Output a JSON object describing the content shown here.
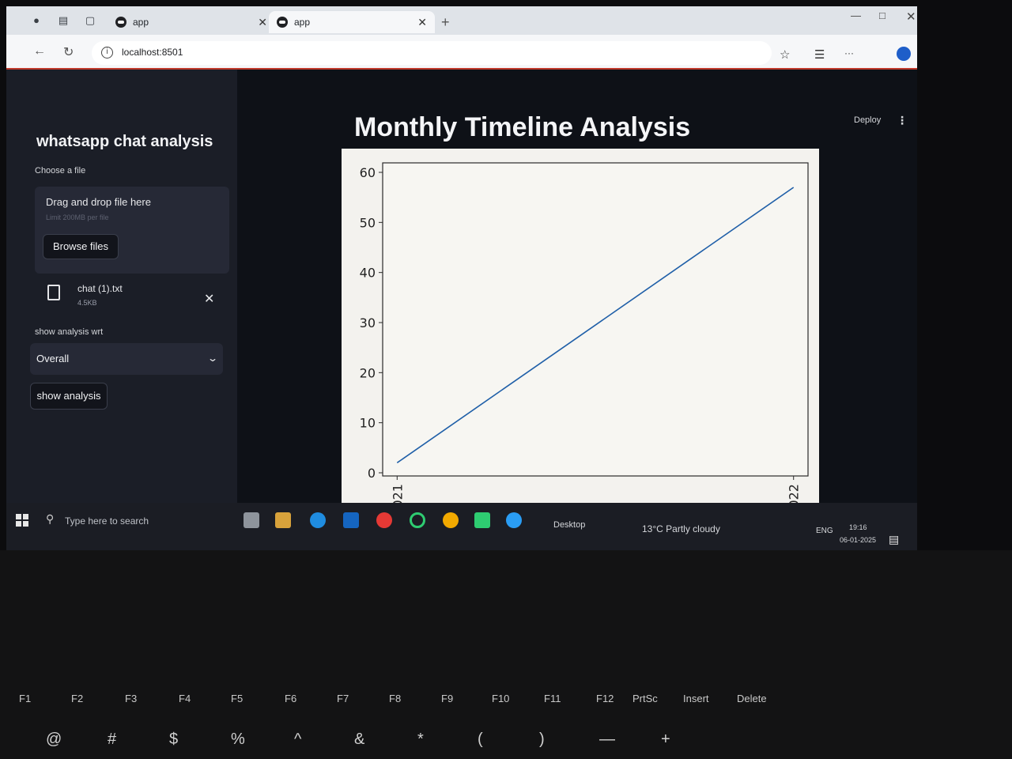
{
  "browser": {
    "tabs": [
      {
        "label": "app"
      },
      {
        "label": "app"
      }
    ],
    "url": "localhost:8501"
  },
  "sidebar": {
    "title": "whatsapp chat analysis",
    "file_label": "Choose a file",
    "drop_title": "Drag and drop file here",
    "drop_limit": "Limit 200MB per file",
    "browse_label": "Browse files",
    "uploaded_file": {
      "name": "chat (1).txt",
      "size": "4.5KB"
    },
    "select_label": "show analysis wrt",
    "select_value": "Overall",
    "show_button": "show analysis"
  },
  "header": {
    "deploy_label": "Deploy"
  },
  "main": {
    "page_title": "Monthly Timeline Analysis"
  },
  "chart_data": {
    "type": "line",
    "title": "",
    "xlabel": "",
    "ylabel": "",
    "x_tick_labels": [
      "021",
      "022"
    ],
    "y_ticks": [
      0,
      10,
      20,
      30,
      40,
      50,
      60
    ],
    "ylim": [
      0,
      60
    ],
    "series": [
      {
        "x": [
          0,
          1
        ],
        "values": [
          2,
          57
        ],
        "color": "#1f5fa8"
      }
    ],
    "grid": false
  },
  "taskbar": {
    "search_placeholder": "Type here to search",
    "desktop_label": "Desktop",
    "weather": "13°C  Partly cloudy",
    "language": "ENG",
    "time": "19:16",
    "date": "06-01-2025"
  },
  "keyboard": {
    "fkeys": [
      "F1",
      "F2",
      "F3",
      "F4",
      "F5",
      "F6",
      "F7",
      "F8",
      "F9",
      "F10",
      "F11",
      "F12",
      "PrtSc",
      "Insert",
      "Delete"
    ],
    "symbols": [
      "@",
      "#",
      "$",
      "%",
      "^",
      "&",
      "*",
      "(",
      ")",
      "—",
      "+"
    ]
  }
}
